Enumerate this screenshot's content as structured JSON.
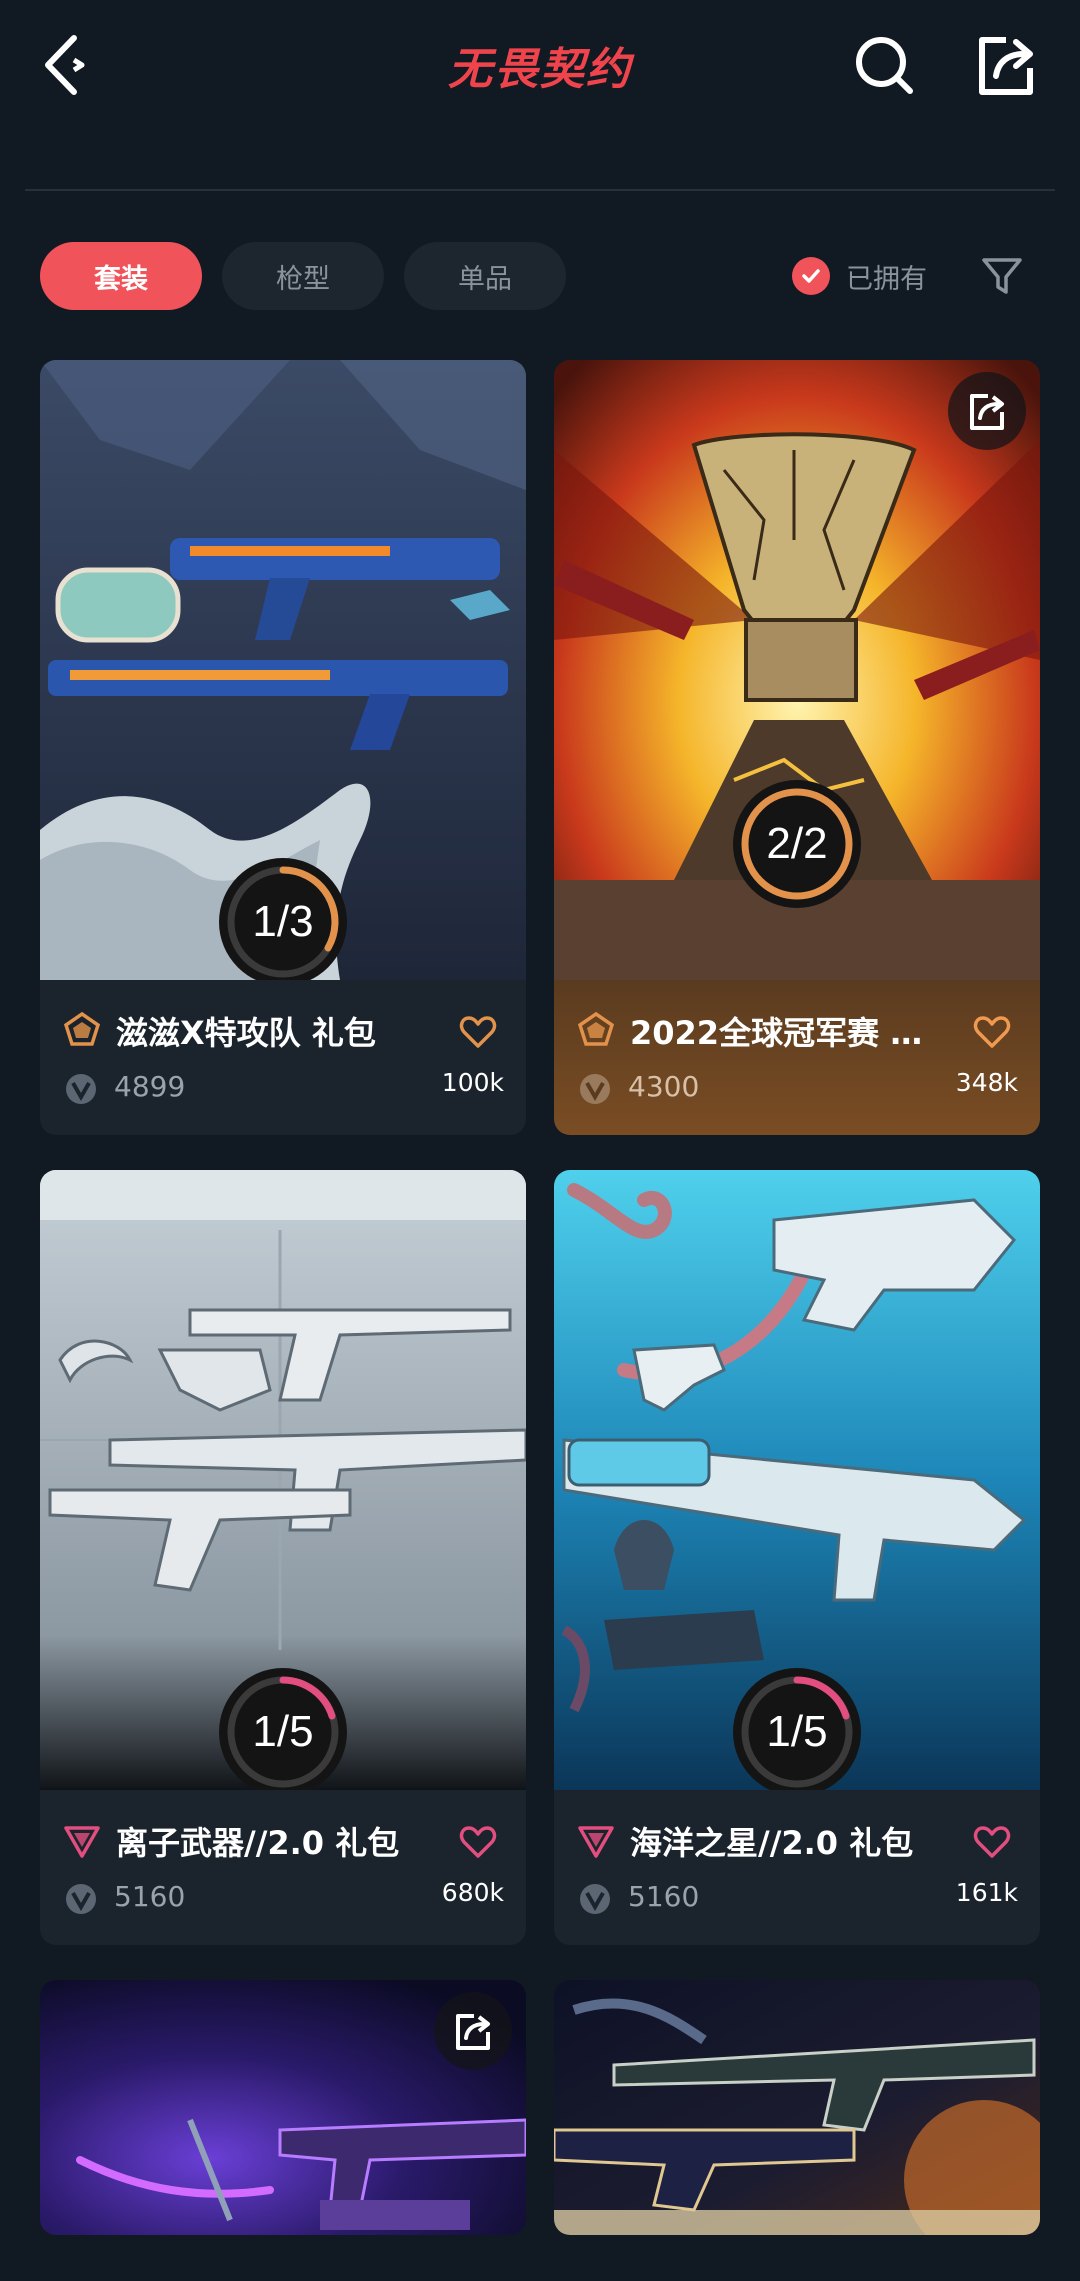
{
  "header": {
    "logo_text": "无畏契约"
  },
  "tabs": [
    {
      "label": "套装",
      "active": true
    },
    {
      "label": "枪型",
      "active": false
    },
    {
      "label": "单品",
      "active": false
    }
  ],
  "owned_filter": {
    "label": "已拥有",
    "checked": true
  },
  "colors": {
    "accent": "#f0545a",
    "background": "#111922",
    "card": "#1b232c",
    "gold_tier": "#e2924a",
    "pink_tier": "#e24e7f"
  },
  "cards": [
    {
      "title": "滋滋X特攻队 礼包",
      "price": "4899",
      "likes": "100k",
      "progress": "1/3",
      "owned": 1,
      "total": 3,
      "tier": "gold-tier"
    },
    {
      "title": "2022全球冠军赛 礼...",
      "price": "4300",
      "likes": "348k",
      "progress": "2/2",
      "owned": 2,
      "total": 2,
      "tier": "gold-tier"
    },
    {
      "title": "离子武器//2.0 礼包",
      "price": "5160",
      "likes": "680k",
      "progress": "1/5",
      "owned": 1,
      "total": 5,
      "tier": "pink-tier"
    },
    {
      "title": "海洋之星//2.0 礼包",
      "price": "5160",
      "likes": "161k",
      "progress": "1/5",
      "owned": 1,
      "total": 5,
      "tier": "pink-tier"
    }
  ]
}
